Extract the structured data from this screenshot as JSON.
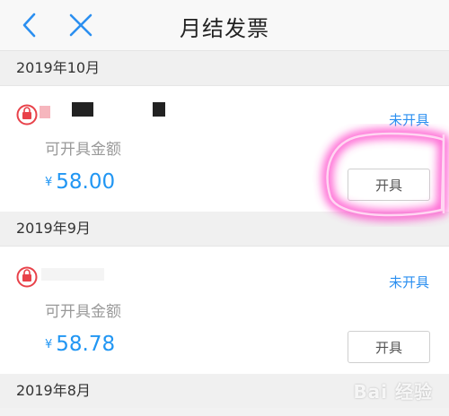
{
  "header": {
    "title": "月结发票"
  },
  "months": [
    {
      "label": "2019年10月",
      "card": {
        "status": "未开具",
        "amount_label": "可开具金额",
        "currency": "¥",
        "amount": "58.00",
        "button": "开具"
      }
    },
    {
      "label": "2019年9月",
      "card": {
        "status": "未开具",
        "amount_label": "可开具金额",
        "currency": "¥",
        "amount": "58.78",
        "button": "开具"
      }
    },
    {
      "label": "2019年8月"
    }
  ],
  "watermark": "Bai 经验",
  "colors": {
    "accent": "#2196f3",
    "status": "#2b8ff0",
    "icon_red": "#e8424a",
    "highlight": "#ff3cc8"
  },
  "icons": [
    "back-arrow-icon",
    "close-icon",
    "shop-icon"
  ]
}
